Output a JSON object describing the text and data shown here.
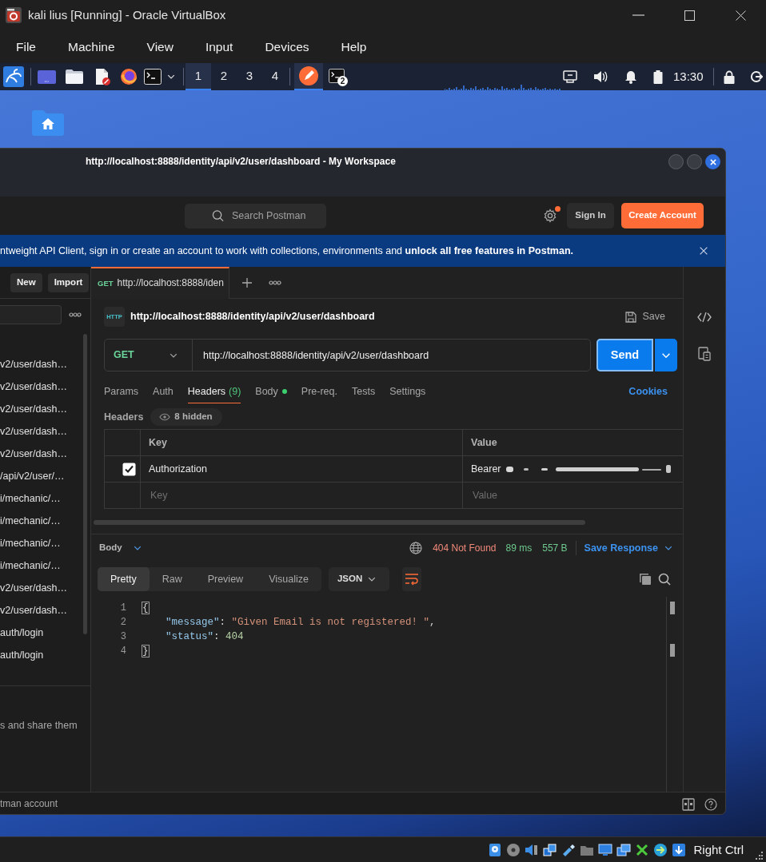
{
  "vbox": {
    "title": "kali lius [Running] - Oracle VirtualBox",
    "menu": [
      "File",
      "Machine",
      "View",
      "Input",
      "Devices",
      "Help"
    ],
    "host_key": "Right Ctrl"
  },
  "panel": {
    "workspaces": [
      {
        "label": "1",
        "selected": true
      },
      {
        "label": "2",
        "selected": false
      },
      {
        "label": "3",
        "selected": false
      },
      {
        "label": "4",
        "selected": false
      }
    ],
    "tasks": [
      {
        "kind": "pen",
        "selected": true
      },
      {
        "kind": "terminal",
        "selected": false,
        "badge": "2"
      }
    ],
    "clock": "13:30"
  },
  "postman": {
    "title": "http://localhost:8888/identity/api/v2/user/dashboard - My Workspace",
    "search_placeholder": "Search Postman",
    "settings_notification": true,
    "sign_in": "Sign In",
    "create_account": "Create Account",
    "banner": "ntweight API Client, sign in or create an account to work with collections, environments and **unlock all free features in Postman.**",
    "sidebar": {
      "buttons": [
        "New",
        "Import"
      ],
      "items": [
        "v2/user/dash…",
        "v2/user/dash…",
        "v2/user/dash…",
        "v2/user/dash…",
        "v2/user/dash…",
        "/api/v2/user/…",
        "i/mechanic/…",
        "i/mechanic/…",
        "i/mechanic/…",
        "i/mechanic/…",
        "v2/user/dash…",
        "v2/user/dash…",
        "auth/login",
        "auth/login"
      ],
      "hint": "s and share them"
    },
    "tabs": [
      {
        "method": "GET",
        "label": "http://localhost:8888/iden",
        "selected": true
      }
    ],
    "request": {
      "icon_label": "HTTP",
      "name": "http://localhost:8888/identity/api/v2/user/dashboard",
      "save": "Save",
      "method": "GET",
      "url": "http://localhost:8888/identity/api/v2/user/dashboard",
      "send": "Send",
      "tabs": [
        {
          "label": "Params",
          "selected": false,
          "indicator": false
        },
        {
          "label": "Auth",
          "selected": false,
          "indicator": false
        },
        {
          "label": "Headers",
          "count": "(9)",
          "selected": true,
          "indicator": false
        },
        {
          "label": "Body",
          "selected": false,
          "indicator": true
        },
        {
          "label": "Pre-req.",
          "selected": false,
          "indicator": false
        },
        {
          "label": "Tests",
          "selected": false,
          "indicator": false
        },
        {
          "label": "Settings",
          "selected": false,
          "indicator": false
        }
      ],
      "cookies": "Cookies",
      "headers_title": "Headers",
      "hidden": "8 hidden",
      "columns": [
        "Key",
        "Value"
      ],
      "rows": [
        {
          "checked": true,
          "key": "Authorization",
          "value": "Bearer",
          "redacted": true
        }
      ],
      "new_row": {
        "key_placeholder": "Key",
        "value_placeholder": "Value"
      }
    },
    "response": {
      "label": "Body",
      "status": "404 Not Found",
      "time": "89 ms",
      "size": "557 B",
      "save": "Save Response",
      "views": [
        {
          "label": "Pretty",
          "selected": true
        },
        {
          "label": "Raw",
          "selected": false
        },
        {
          "label": "Preview",
          "selected": false
        },
        {
          "label": "Visualize",
          "selected": false
        }
      ],
      "format": "JSON",
      "lines": [
        {
          "number": "1",
          "tokens": [
            {
              "kind": "brace",
              "text": "{"
            }
          ]
        },
        {
          "number": "2",
          "tokens": [
            {
              "kind": "key",
              "text": "    \"message\""
            },
            {
              "kind": "punct",
              "text": ": "
            },
            {
              "kind": "string",
              "text": "\"Given Email is not registered! \""
            },
            {
              "kind": "punct",
              "text": ","
            }
          ]
        },
        {
          "number": "3",
          "tokens": [
            {
              "kind": "key",
              "text": "    \"status\""
            },
            {
              "kind": "punct",
              "text": ": "
            },
            {
              "kind": "number",
              "text": "404"
            }
          ]
        },
        {
          "number": "4",
          "tokens": [
            {
              "kind": "brace",
              "text": "}"
            }
          ]
        }
      ]
    },
    "status_bar": {
      "text": "tman account"
    }
  }
}
